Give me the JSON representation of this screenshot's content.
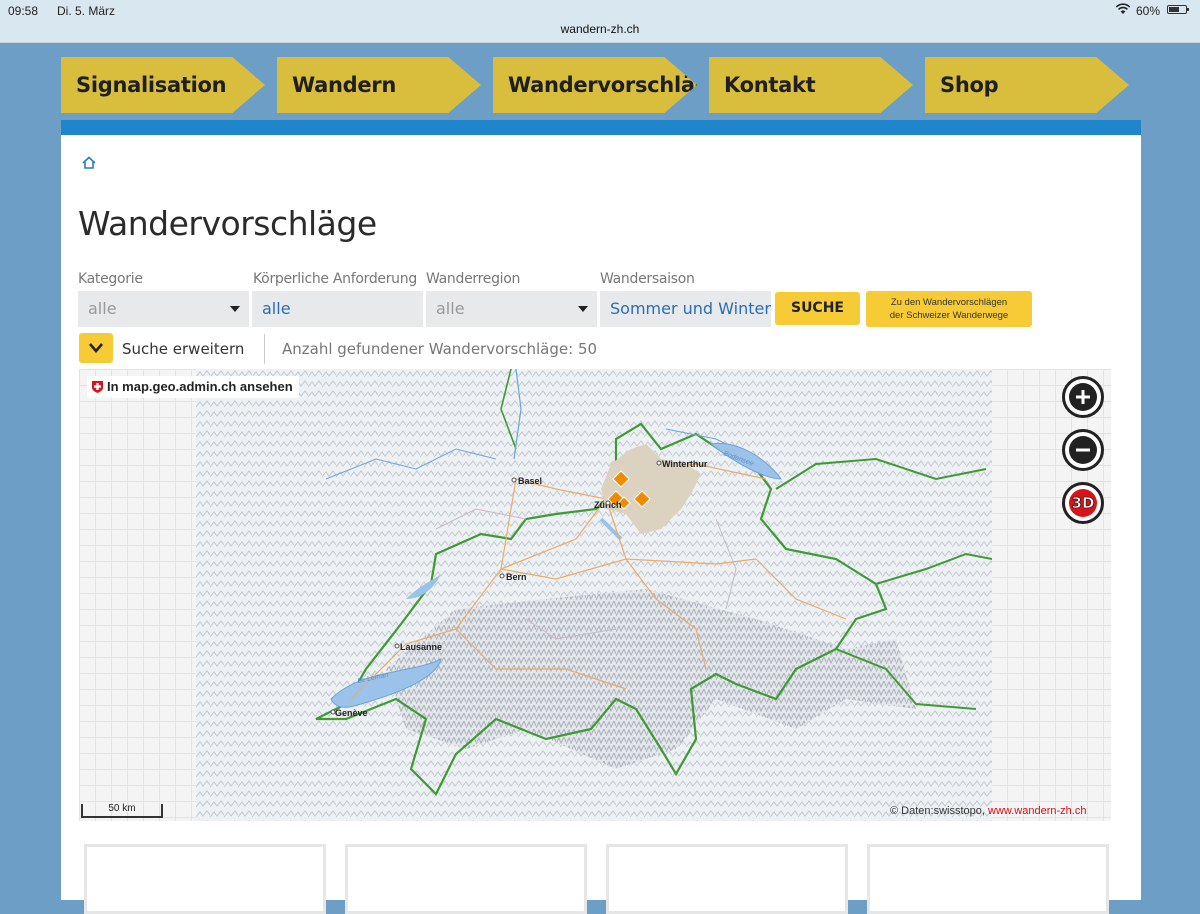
{
  "status_bar": {
    "time": "09:58",
    "date": "Di. 5. März",
    "url": "wandern-zh.ch",
    "battery": "60%",
    "battery_level": 0.6
  },
  "nav": {
    "items": [
      {
        "label": "Signalisation"
      },
      {
        "label": "Wandern"
      },
      {
        "label": "Wandervorschläge"
      },
      {
        "label": "Kontakt"
      },
      {
        "label": "Shop"
      }
    ]
  },
  "breadcrumb": {
    "icon": "home-icon"
  },
  "page": {
    "title": "Wandervorschläge"
  },
  "filters": {
    "kategorie": {
      "label": "Kategorie",
      "value": "alle"
    },
    "anforderung": {
      "label": "Körperliche Anforderung",
      "value": "alle"
    },
    "region": {
      "label": "Wanderregion",
      "value": "alle"
    },
    "saison": {
      "label": "Wandersaison",
      "value": "Sommer und Winter"
    },
    "search_button": "SUCHE",
    "schweizer_link_line1": "Zu den Wandervorschlägen",
    "schweizer_link_line2": "der Schweizer Wanderwege",
    "expand_label": "Suche erweitern",
    "result_count": "Anzahl gefundener Wandervorschläge: 50"
  },
  "map": {
    "geo_link": "In map.geo.admin.ch ansehen",
    "scale": "50 km",
    "attribution_prefix": "© Daten:swisstopo,",
    "attribution_link": "www.wandern-zh.ch",
    "cities": [
      {
        "name": "Basel"
      },
      {
        "name": "Winterthur"
      },
      {
        "name": "Zürich"
      },
      {
        "name": "Bern"
      },
      {
        "name": "Lausanne"
      },
      {
        "name": "Genève"
      }
    ],
    "lakes": [
      "Bodensee",
      "Le Léman"
    ],
    "zoom_in_icon": "plus-icon",
    "zoom_out_icon": "minus-icon",
    "view_3d_label": "3D"
  },
  "colors": {
    "nav": "#d9bd3c",
    "accent_blue": "#1f86cb",
    "button_yellow": "#f6cb35",
    "marker_orange": "#f08a00",
    "border_green": "#3f9a35"
  }
}
